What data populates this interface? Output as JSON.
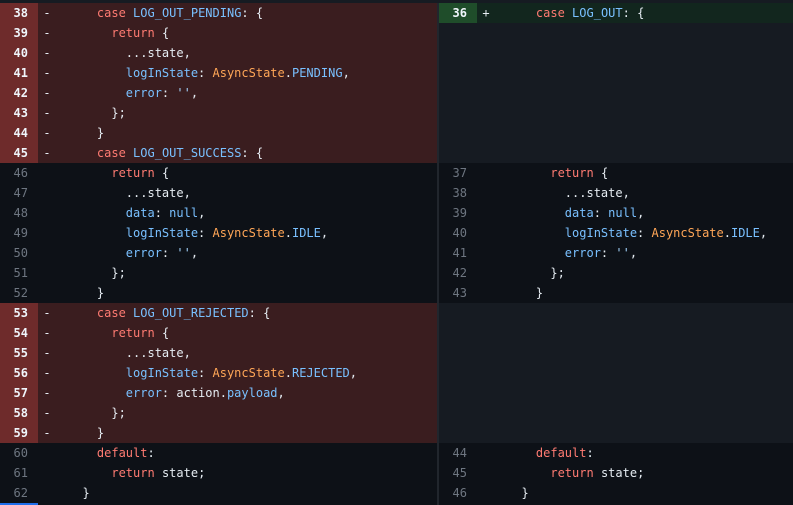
{
  "diff": {
    "left": [
      {
        "type": "del",
        "num": "38",
        "marker": "-",
        "tokens": [
          {
            "t": "    "
          },
          {
            "t": "case",
            "c": "kw"
          },
          {
            "t": " "
          },
          {
            "t": "LOG_OUT_PENDING",
            "c": "prop"
          },
          {
            "t": ": {"
          }
        ]
      },
      {
        "type": "del",
        "num": "39",
        "marker": "-",
        "tokens": [
          {
            "t": "      "
          },
          {
            "t": "return",
            "c": "kw"
          },
          {
            "t": " {"
          }
        ]
      },
      {
        "type": "del",
        "num": "40",
        "marker": "-",
        "tokens": [
          {
            "t": "        ...state,"
          }
        ]
      },
      {
        "type": "del",
        "num": "41",
        "marker": "-",
        "tokens": [
          {
            "t": "        "
          },
          {
            "t": "logInState",
            "c": "prop"
          },
          {
            "t": ": "
          },
          {
            "t": "AsyncState",
            "c": "type"
          },
          {
            "t": "."
          },
          {
            "t": "PENDING",
            "c": "const"
          },
          {
            "t": ","
          }
        ]
      },
      {
        "type": "del",
        "num": "42",
        "marker": "-",
        "tokens": [
          {
            "t": "        "
          },
          {
            "t": "error",
            "c": "prop"
          },
          {
            "t": ": "
          },
          {
            "t": "''",
            "c": "str"
          },
          {
            "t": ","
          }
        ]
      },
      {
        "type": "del",
        "num": "43",
        "marker": "-",
        "tokens": [
          {
            "t": "      };"
          }
        ]
      },
      {
        "type": "del",
        "num": "44",
        "marker": "-",
        "tokens": [
          {
            "t": "    }"
          }
        ]
      },
      {
        "type": "del",
        "num": "45",
        "marker": "-",
        "tokens": [
          {
            "t": "    "
          },
          {
            "t": "case",
            "c": "kw"
          },
          {
            "t": " "
          },
          {
            "t": "LOG_OUT_SUCCESS",
            "c": "prop"
          },
          {
            "t": ": {"
          }
        ]
      },
      {
        "type": "ctx",
        "num": "46",
        "marker": "",
        "tokens": [
          {
            "t": "      "
          },
          {
            "t": "return",
            "c": "kw"
          },
          {
            "t": " {"
          }
        ]
      },
      {
        "type": "ctx",
        "num": "47",
        "marker": "",
        "tokens": [
          {
            "t": "        ...state,"
          }
        ]
      },
      {
        "type": "ctx",
        "num": "48",
        "marker": "",
        "tokens": [
          {
            "t": "        "
          },
          {
            "t": "data",
            "c": "prop"
          },
          {
            "t": ": "
          },
          {
            "t": "null",
            "c": "const"
          },
          {
            "t": ","
          }
        ]
      },
      {
        "type": "ctx",
        "num": "49",
        "marker": "",
        "tokens": [
          {
            "t": "        "
          },
          {
            "t": "logInState",
            "c": "prop"
          },
          {
            "t": ": "
          },
          {
            "t": "AsyncState",
            "c": "type"
          },
          {
            "t": "."
          },
          {
            "t": "IDLE",
            "c": "const"
          },
          {
            "t": ","
          }
        ]
      },
      {
        "type": "ctx",
        "num": "50",
        "marker": "",
        "tokens": [
          {
            "t": "        "
          },
          {
            "t": "error",
            "c": "prop"
          },
          {
            "t": ": "
          },
          {
            "t": "''",
            "c": "str"
          },
          {
            "t": ","
          }
        ]
      },
      {
        "type": "ctx",
        "num": "51",
        "marker": "",
        "tokens": [
          {
            "t": "      };"
          }
        ]
      },
      {
        "type": "ctx",
        "num": "52",
        "marker": "",
        "tokens": [
          {
            "t": "    }"
          }
        ]
      },
      {
        "type": "del",
        "num": "53",
        "marker": "-",
        "tokens": [
          {
            "t": "    "
          },
          {
            "t": "case",
            "c": "kw"
          },
          {
            "t": " "
          },
          {
            "t": "LOG_OUT_REJECTED",
            "c": "prop"
          },
          {
            "t": ": {"
          }
        ]
      },
      {
        "type": "del",
        "num": "54",
        "marker": "-",
        "tokens": [
          {
            "t": "      "
          },
          {
            "t": "return",
            "c": "kw"
          },
          {
            "t": " {"
          }
        ]
      },
      {
        "type": "del",
        "num": "55",
        "marker": "-",
        "tokens": [
          {
            "t": "        ...state,"
          }
        ]
      },
      {
        "type": "del",
        "num": "56",
        "marker": "-",
        "tokens": [
          {
            "t": "        "
          },
          {
            "t": "logInState",
            "c": "prop"
          },
          {
            "t": ": "
          },
          {
            "t": "AsyncState",
            "c": "type"
          },
          {
            "t": "."
          },
          {
            "t": "REJECTED",
            "c": "const"
          },
          {
            "t": ","
          }
        ]
      },
      {
        "type": "del",
        "num": "57",
        "marker": "-",
        "tokens": [
          {
            "t": "        "
          },
          {
            "t": "error",
            "c": "prop"
          },
          {
            "t": ": action."
          },
          {
            "t": "payload",
            "c": "prop"
          },
          {
            "t": ","
          }
        ]
      },
      {
        "type": "del",
        "num": "58",
        "marker": "-",
        "tokens": [
          {
            "t": "      };"
          }
        ]
      },
      {
        "type": "del",
        "num": "59",
        "marker": "-",
        "tokens": [
          {
            "t": "    }"
          }
        ]
      },
      {
        "type": "ctx",
        "num": "60",
        "marker": "",
        "tokens": [
          {
            "t": "    "
          },
          {
            "t": "default",
            "c": "kw"
          },
          {
            "t": ":"
          }
        ]
      },
      {
        "type": "ctx",
        "num": "61",
        "marker": "",
        "tokens": [
          {
            "t": "      "
          },
          {
            "t": "return",
            "c": "kw"
          },
          {
            "t": " state;"
          }
        ]
      },
      {
        "type": "ctx",
        "num": "62",
        "marker": "",
        "tokens": [
          {
            "t": "  }"
          }
        ]
      }
    ],
    "right": [
      {
        "type": "add",
        "num": "36",
        "marker": "+",
        "tokens": [
          {
            "t": "    "
          },
          {
            "t": "case",
            "c": "kw"
          },
          {
            "t": " "
          },
          {
            "t": "LOG_OUT",
            "c": "prop"
          },
          {
            "t": ": {"
          }
        ]
      },
      {
        "type": "empty",
        "num": "",
        "marker": "",
        "tokens": []
      },
      {
        "type": "empty",
        "num": "",
        "marker": "",
        "tokens": []
      },
      {
        "type": "empty",
        "num": "",
        "marker": "",
        "tokens": []
      },
      {
        "type": "empty",
        "num": "",
        "marker": "",
        "tokens": []
      },
      {
        "type": "empty",
        "num": "",
        "marker": "",
        "tokens": []
      },
      {
        "type": "empty",
        "num": "",
        "marker": "",
        "tokens": []
      },
      {
        "type": "empty",
        "num": "",
        "marker": "",
        "tokens": []
      },
      {
        "type": "ctx",
        "num": "37",
        "marker": "",
        "tokens": [
          {
            "t": "      "
          },
          {
            "t": "return",
            "c": "kw"
          },
          {
            "t": " {"
          }
        ]
      },
      {
        "type": "ctx",
        "num": "38",
        "marker": "",
        "tokens": [
          {
            "t": "        ...state,"
          }
        ]
      },
      {
        "type": "ctx",
        "num": "39",
        "marker": "",
        "tokens": [
          {
            "t": "        "
          },
          {
            "t": "data",
            "c": "prop"
          },
          {
            "t": ": "
          },
          {
            "t": "null",
            "c": "const"
          },
          {
            "t": ","
          }
        ]
      },
      {
        "type": "ctx",
        "num": "40",
        "marker": "",
        "tokens": [
          {
            "t": "        "
          },
          {
            "t": "logInState",
            "c": "prop"
          },
          {
            "t": ": "
          },
          {
            "t": "AsyncState",
            "c": "type"
          },
          {
            "t": "."
          },
          {
            "t": "IDLE",
            "c": "const"
          },
          {
            "t": ","
          }
        ]
      },
      {
        "type": "ctx",
        "num": "41",
        "marker": "",
        "tokens": [
          {
            "t": "        "
          },
          {
            "t": "error",
            "c": "prop"
          },
          {
            "t": ": "
          },
          {
            "t": "''",
            "c": "str"
          },
          {
            "t": ","
          }
        ]
      },
      {
        "type": "ctx",
        "num": "42",
        "marker": "",
        "tokens": [
          {
            "t": "      };"
          }
        ]
      },
      {
        "type": "ctx",
        "num": "43",
        "marker": "",
        "tokens": [
          {
            "t": "    }"
          }
        ]
      },
      {
        "type": "empty",
        "num": "",
        "marker": "",
        "tokens": []
      },
      {
        "type": "empty",
        "num": "",
        "marker": "",
        "tokens": []
      },
      {
        "type": "empty",
        "num": "",
        "marker": "",
        "tokens": []
      },
      {
        "type": "empty",
        "num": "",
        "marker": "",
        "tokens": []
      },
      {
        "type": "empty",
        "num": "",
        "marker": "",
        "tokens": []
      },
      {
        "type": "empty",
        "num": "",
        "marker": "",
        "tokens": []
      },
      {
        "type": "empty",
        "num": "",
        "marker": "",
        "tokens": []
      },
      {
        "type": "ctx",
        "num": "44",
        "marker": "",
        "tokens": [
          {
            "t": "    "
          },
          {
            "t": "default",
            "c": "kw"
          },
          {
            "t": ":"
          }
        ]
      },
      {
        "type": "ctx",
        "num": "45",
        "marker": "",
        "tokens": [
          {
            "t": "      "
          },
          {
            "t": "return",
            "c": "kw"
          },
          {
            "t": " state;"
          }
        ]
      },
      {
        "type": "ctx",
        "num": "46",
        "marker": "",
        "tokens": [
          {
            "t": "  }"
          }
        ]
      }
    ]
  },
  "colors": {
    "background": "#0d1117",
    "deleted_line_bg": "#3a1d1f",
    "deleted_num_bg": "#6e2b2b",
    "added_line_bg": "#12261e",
    "added_num_bg": "#1f4d2a",
    "empty_bg": "#161b22",
    "keyword": "#ff7b72",
    "property": "#79c0ff",
    "type": "#ffa657",
    "string": "#a5d6ff"
  }
}
